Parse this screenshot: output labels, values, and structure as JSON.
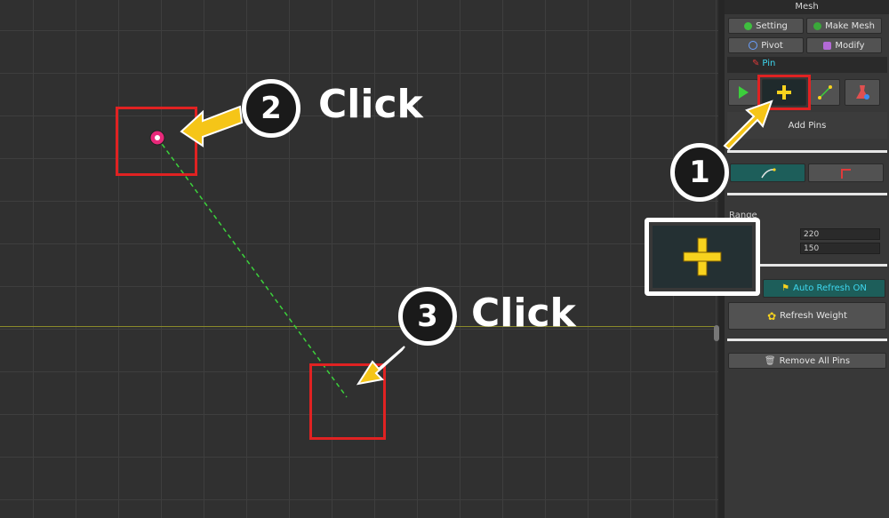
{
  "panel": {
    "title": "Mesh",
    "buttons": {
      "setting": "Setting",
      "make_mesh": "Make Mesh",
      "pivot": "Pivot",
      "modify": "Modify"
    },
    "pin_tab": "Pin",
    "add_pins_label": "Add Pins",
    "range_label": "Range",
    "fields": {
      "value1": "220",
      "value2": "150"
    },
    "auto_refresh_label": "Auto Refresh ON",
    "refresh_weight_label": "Refresh Weight",
    "remove_all_pins_label": "Remove All Pins"
  },
  "annotations": {
    "step1_number": "1",
    "step2_number": "2",
    "step3_number": "3",
    "step2_text": "Click",
    "step3_text": "Click"
  },
  "colors": {
    "accent_teal": "#1d5e5a",
    "highlight_red": "#e02222",
    "arrow_yellow": "#f5c518",
    "pin_pink": "#e8287a",
    "guide_green": "#3bd23b"
  },
  "icons": [
    "select-arrow-icon",
    "add-pin-icon",
    "link-pins-icon",
    "test-pin-icon",
    "curve-icon",
    "corner-icon",
    "auto-refresh-icon",
    "refresh-weight-icon",
    "trash-icon",
    "pin-icon"
  ]
}
